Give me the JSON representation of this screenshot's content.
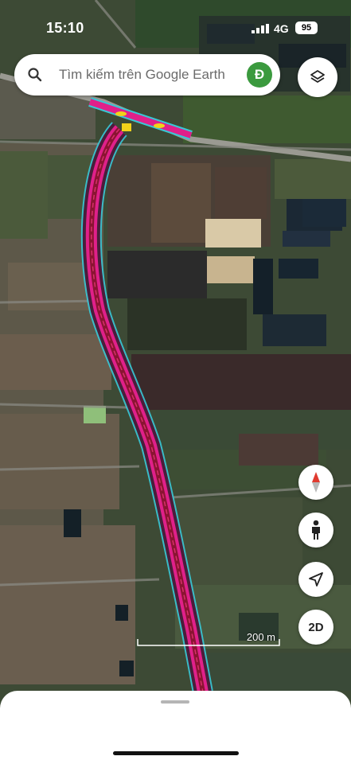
{
  "status_bar": {
    "time": "15:10",
    "network": "4G",
    "battery": "95"
  },
  "search": {
    "placeholder": "Tìm kiếm trên Google Earth",
    "avatar_letter": "Đ"
  },
  "controls": {
    "layers_icon": "layers-icon",
    "compass_icon": "compass-icon",
    "person_icon": "street-view-person-icon",
    "locate_icon": "location-arrow-icon",
    "view_mode_label": "2D"
  },
  "map": {
    "scale_label": "200 m",
    "route_color": "#e0208a",
    "route_outline_color": "#38c8d6",
    "marker_color": "#f2d21a"
  }
}
